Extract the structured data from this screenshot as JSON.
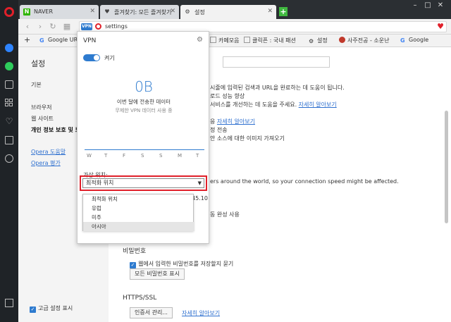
{
  "tabs": [
    {
      "label": "NAVER",
      "icon_color": "#2db400",
      "icon_char": "N"
    },
    {
      "label": "즐겨찾기: 모든 즐겨찾기",
      "icon_char": "♥"
    },
    {
      "label": "설정",
      "icon_char": "⚙"
    }
  ],
  "window_controls": {
    "minimize": "–",
    "maximize": "□",
    "close": "✕"
  },
  "address": {
    "vpn_badge": "VPN",
    "url": "settings"
  },
  "bookmarks": [
    {
      "label": "Google URL"
    },
    {
      "label": "카페모음"
    },
    {
      "label": "클릭픈 : 국내 패션"
    },
    {
      "label": "설정"
    },
    {
      "label": "사주전공 - 소운난"
    },
    {
      "label": "Google"
    }
  ],
  "settings_nav": {
    "title": "설정",
    "items": [
      "기본",
      "브라우저",
      "웹 사이트",
      "개인 정보 보호 및 보안"
    ],
    "links": [
      "Opera 도움말",
      "Opera 평가"
    ],
    "advanced_label": "고급 설정 표시"
  },
  "content": {
    "privacy_lines": [
      "시줄에 입력된 검색과 URL을 완료하는 데 도움이 됩니다.",
      "로드 성능 향상",
      "서비스를 개선하는 데 도움을 주세요."
    ],
    "learn_more": "자세히 알아보기",
    "line_sub1": "응",
    "line_sub2": "정 전송",
    "line_sub3": "안 소스에 대한 이미지 가져오기",
    "vpn_desc": "ers around the world, so your connection speed might be affected.",
    "autofill_suffix": "동 완성 사용",
    "passwords_head": "비밀번호",
    "passwords_option": "웹에서 입력한 비밀번호를 저장할지 묻기",
    "show_passwords_btn": "모든 비밀번호 표시",
    "https_head": "HTTPS/SSL",
    "cert_btn": "인증서 관리...",
    "cert_learn": "자세히 알아보기"
  },
  "vpn": {
    "title": "VPN",
    "toggle_label": "켜기",
    "amount": "0B",
    "sub1": "이번 달에 전송한 데이터",
    "sub2": "무제한 VPN 데이터 사용 중",
    "days": [
      "W",
      "T",
      "F",
      "S",
      "S",
      "M",
      "T"
    ],
    "location_label": "가상 위치:",
    "selected_location": "최적화 위치",
    "options": [
      "최적화 위치",
      "유럽",
      "미주",
      "아시아"
    ],
    "ip_suffix": "45.10"
  }
}
